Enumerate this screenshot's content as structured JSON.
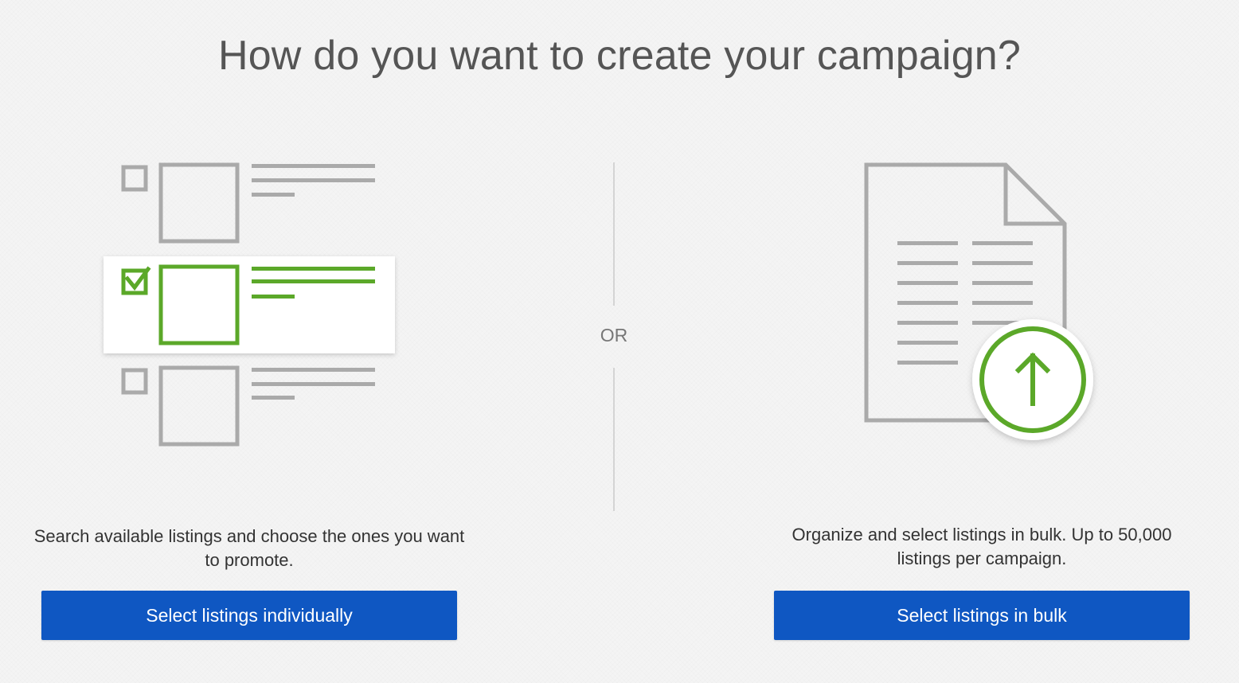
{
  "page": {
    "title": "How do you want to create your campaign?"
  },
  "divider": {
    "label": "OR"
  },
  "options": {
    "individual": {
      "description": "Search available listings and choose the ones you want to promote.",
      "button_label": "Select listings individually",
      "icon": "listing-checklist-icon"
    },
    "bulk": {
      "description": "Organize and select listings in bulk. Up to 50,000 listings per campaign.",
      "button_label": "Select listings in bulk",
      "icon": "document-upload-icon"
    }
  },
  "colors": {
    "accent_green": "#5ba829",
    "button_blue": "#0f57c2",
    "icon_gray": "#aaaaaa"
  }
}
